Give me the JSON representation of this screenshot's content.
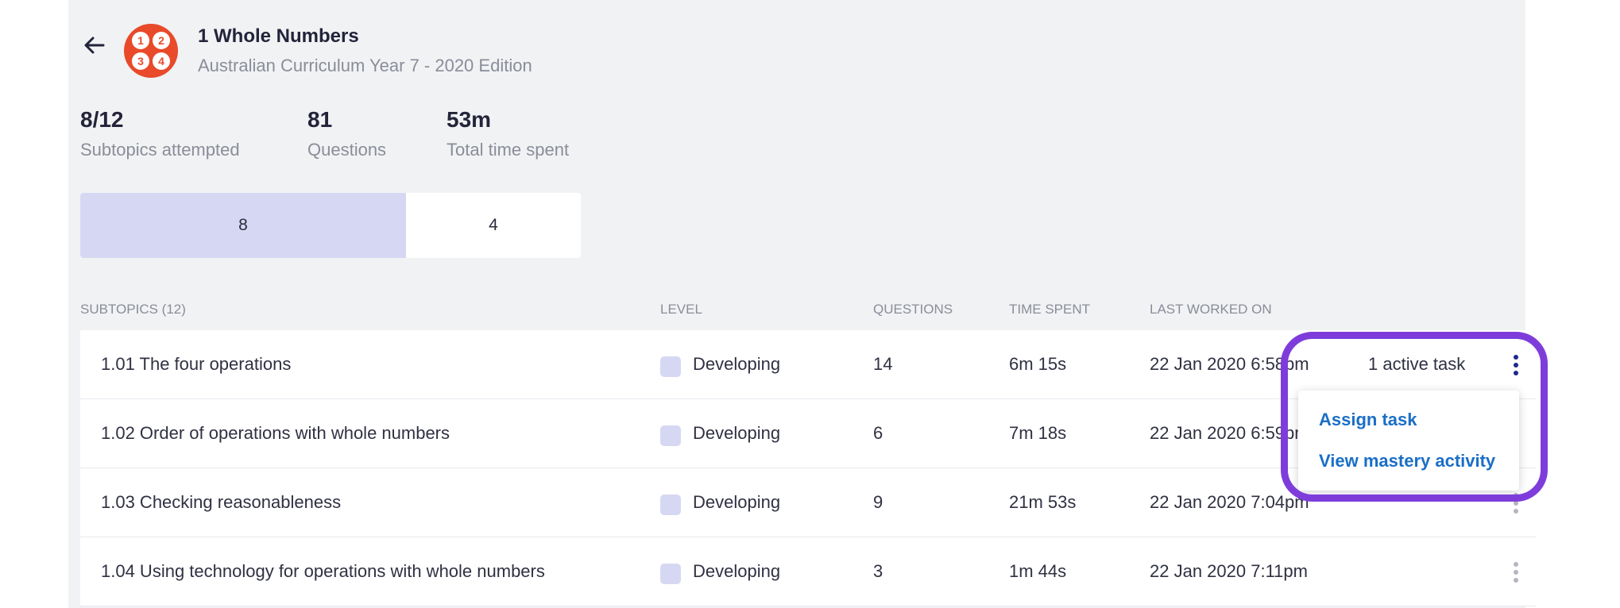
{
  "header": {
    "title": "1 Whole Numbers",
    "subtitle": "Australian Curriculum Year 7 - 2020 Edition",
    "logo_digits": [
      "1",
      "2",
      "3",
      "4"
    ]
  },
  "stats": [
    {
      "value": "8/12",
      "label": "Subtopics attempted"
    },
    {
      "value": "81",
      "label": "Questions"
    },
    {
      "value": "53m",
      "label": "Total time spent"
    }
  ],
  "progress": {
    "attempted": "8",
    "remaining": "4"
  },
  "table": {
    "headers": [
      "SUBTOPICS (12)",
      "LEVEL",
      "QUESTIONS",
      "TIME SPENT",
      "LAST WORKED ON"
    ],
    "rows": [
      {
        "subtopic": "1.01 The four operations",
        "level": "Developing",
        "questions": "14",
        "time": "6m 15s",
        "last": "22 Jan 2020 6:58pm",
        "task": "1 active task"
      },
      {
        "subtopic": "1.02 Order of operations with whole numbers",
        "level": "Developing",
        "questions": "6",
        "time": "7m 18s",
        "last": "22 Jan 2020 6:59pm",
        "task": ""
      },
      {
        "subtopic": "1.03 Checking reasonableness",
        "level": "Developing",
        "questions": "9",
        "time": "21m 53s",
        "last": "22 Jan 2020 7:04pm",
        "task": ""
      },
      {
        "subtopic": "1.04 Using technology for operations with whole numbers",
        "level": "Developing",
        "questions": "3",
        "time": "1m 44s",
        "last": "22 Jan 2020 7:11pm",
        "task": ""
      }
    ]
  },
  "menu": {
    "items": [
      "Assign task",
      "View mastery activity"
    ]
  },
  "colors": {
    "accent": "#7e3ddb",
    "link": "#1a6ec7",
    "level_fill": "#d6d8f3",
    "logo": "#e84a2a"
  }
}
